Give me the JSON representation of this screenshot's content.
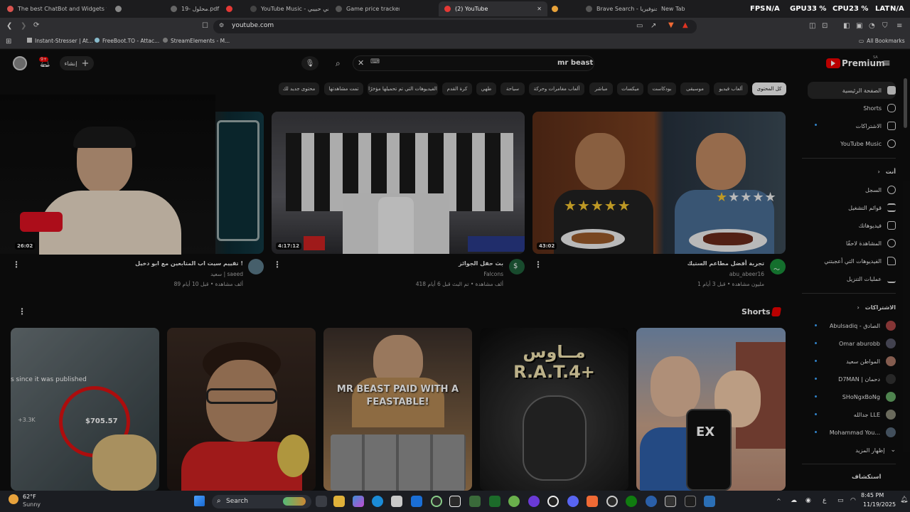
{
  "tabs": [
    {
      "label": "The best ChatBot and Widgets for K",
      "color": "#d9534f"
    },
    {
      "label": "",
      "color": "#888888"
    },
    {
      "label": "19- محلول.pdf",
      "color": "#888888"
    },
    {
      "label": "",
      "color": "#e53935"
    },
    {
      "label": "YouTube Music - ميني حبيبي",
      "color": "#888888"
    },
    {
      "label": "Game price tracker",
      "color": "#888888"
    },
    {
      "label": "(2) YouTube",
      "color": "#e53935"
    },
    {
      "label": "",
      "color": "#e8a23a"
    },
    {
      "label": "Brave Search - جنوفيريا",
      "color": "#888888"
    },
    {
      "label": "New Tab",
      "color": "#888888"
    }
  ],
  "system_stats": {
    "fps_label": "FPS",
    "fps": "N/A",
    "gpu_label": "GPU",
    "gpu": "33 %",
    "cpu_label": "CPU",
    "cpu": "23 %",
    "lat_label": "LAT",
    "lat": "N/A"
  },
  "address_bar": {
    "url": "youtube.com"
  },
  "bookmarks": [
    "Instant-Stresser | At...",
    "FreeBoot.TO - Attac...",
    "StreamElements - M..."
  ],
  "all_bookmarks": "All Bookmarks",
  "header": {
    "create_label": "إنشاء",
    "notifications": "9+",
    "search_value": "mr beast",
    "logo_label": "Premium",
    "logo_sup": "SA"
  },
  "chips": [
    "كل المحتوى",
    "ألعاب فيديو",
    "موسيقى",
    "بودكاست",
    "ميكسات",
    "مباشر",
    "ألعاب مغامرات وحركة",
    "سياحة",
    "طهي",
    "كرة القدم",
    "الفيديوهات التي تم تحميلها مؤخرًا",
    "تمت مشاهدتها",
    "محتوى جديد لك"
  ],
  "sidebar": {
    "items": [
      {
        "label": "الصفحة الرئيسية",
        "icon": "home-icon"
      },
      {
        "label": "Shorts",
        "icon": "shorts-icon"
      },
      {
        "label": "الاشتراكات",
        "icon": "subscriptions-icon"
      },
      {
        "label": "YouTube Music",
        "icon": "music-icon"
      }
    ],
    "you_label": "أنت",
    "you_items": [
      {
        "label": "السجل",
        "icon": "history-icon"
      },
      {
        "label": "قوائم التشغيل",
        "icon": "playlist-icon"
      },
      {
        "label": "فيديوهاتك",
        "icon": "video-icon"
      },
      {
        "label": "المشاهدة لاحقًا",
        "icon": "clock-icon"
      },
      {
        "label": "الفيديوهات التي أعجبتني",
        "icon": "like-icon"
      },
      {
        "label": "عمليات التنزيل",
        "icon": "download-icon"
      }
    ],
    "subs_label": "الاشتراكات",
    "subs": [
      "Abulsadiq - الصادق",
      "Omar aburobb",
      "المواطن سعيد",
      "D7MAN | دحمان",
      "SHoNgxBoNg",
      "جدالله LLE",
      "Mohammad You..."
    ],
    "show_more": "إظهار المزيد",
    "explore": "استكشاف"
  },
  "videos": [
    {
      "title": "تجربة أفضل مطاعم الستيك",
      "channel": "abu_abeer16",
      "meta": "1 مليون مشاهدة • قبل 3 أيام",
      "duration": "43:02"
    },
    {
      "title": "بث حفل الجوائز",
      "channel": "Falcons",
      "meta": "418 ألف مشاهدة • تم البث قبل 6 أيام",
      "duration": "4:17:12"
    },
    {
      "title": "تقييم سيت اب المتابعين مع ابو دخيل !",
      "channel": "سعيد | saeed",
      "meta": "89 ألف مشاهدة • قبل 10 أيام",
      "duration": "26:02"
    }
  ],
  "shorts_label": "Shorts",
  "shorts": [
    {
      "overlay": "",
      "price": "$705.57",
      "label_top": "s since it was published",
      "stat": "+3.3K"
    },
    {
      "overlay": ""
    },
    {
      "overlay": "MR BEAST PAID WITH A FEASTABLE!"
    },
    {
      "overlay": "مــاوس R.A.T.4+"
    },
    {
      "overlay": "EX"
    }
  ],
  "thumb_texts": {
    "steak_title": "",
    "bowl_label": ""
  },
  "taskbar": {
    "weather_temp": "62°F",
    "weather_desc": "Sunny",
    "search": "Search",
    "time": "8:45 PM",
    "date": "11/19/2025"
  }
}
